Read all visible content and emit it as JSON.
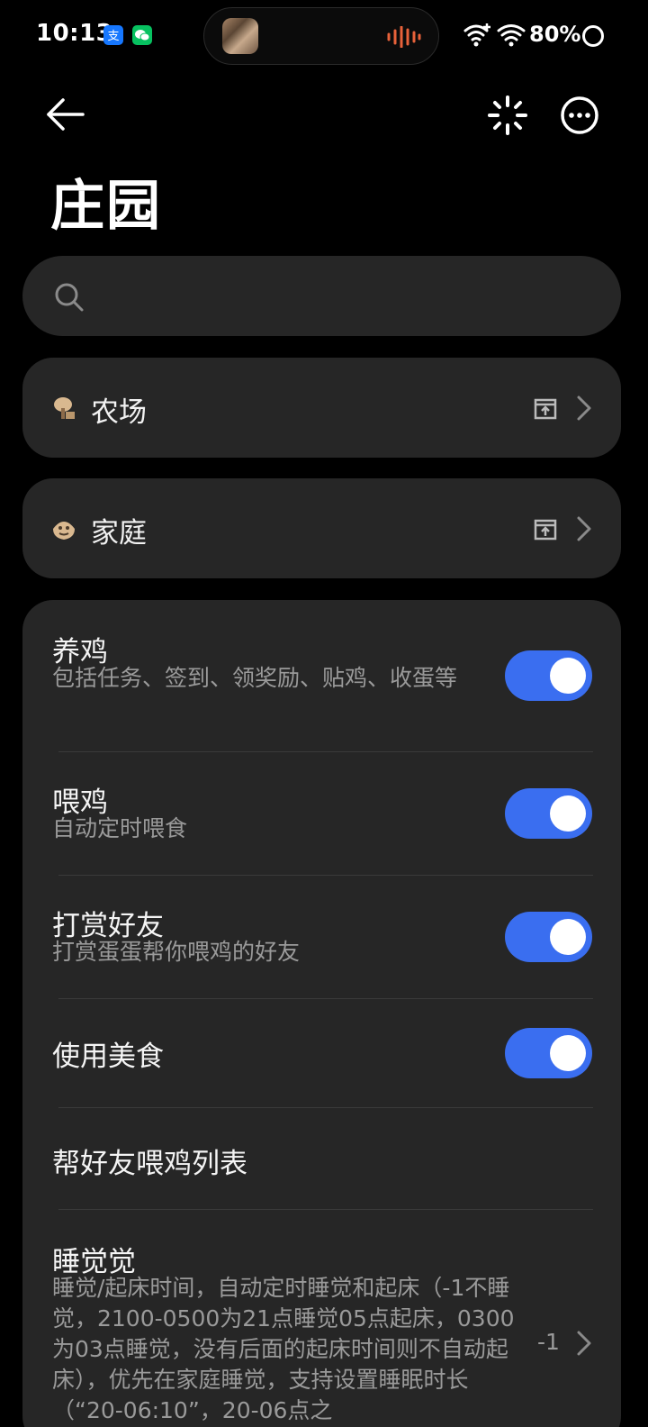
{
  "status_bar": {
    "time": "10:13",
    "battery": "80%",
    "icons": [
      "alipay-icon",
      "wechat-icon",
      "wifi-plus-icon",
      "wifi-icon",
      "battery-ring-icon"
    ]
  },
  "header": {
    "title": "庄园",
    "icons": [
      "back-arrow-icon",
      "sparkle-icon",
      "more-icon"
    ]
  },
  "search": {
    "placeholder": "",
    "value": ""
  },
  "nav_items": [
    {
      "label": "农场",
      "icon": "farm-icon"
    },
    {
      "label": "家庭",
      "icon": "family-icon"
    }
  ],
  "settings": [
    {
      "title": "养鸡",
      "subtitle": "包括任务、签到、领奖励、贴鸡、收蛋等",
      "toggle": true
    },
    {
      "title": "喂鸡",
      "subtitle": "自动定时喂食",
      "toggle": true
    },
    {
      "title": "打赏好友",
      "subtitle": "打赏蛋蛋帮你喂鸡的好友",
      "toggle": true
    },
    {
      "title": "使用美食",
      "subtitle": "",
      "toggle": true
    },
    {
      "title": "帮好友喂鸡列表",
      "subtitle": ""
    },
    {
      "title": "睡觉觉",
      "subtitle": "睡觉/起床时间，自动定时睡觉和起床（-1不睡觉，2100-0500为21点睡觉05点起床，0300为03点睡觉，没有后面的起床时间则不自动起床），优先在家庭睡觉，支持设置睡眠时长（“20-06:10”，20-06点之",
      "value": "-1"
    }
  ],
  "colors": {
    "background": "#000000",
    "card": "#262626",
    "accent": "#3a6ef0",
    "subtext": "#9a9a9a"
  }
}
